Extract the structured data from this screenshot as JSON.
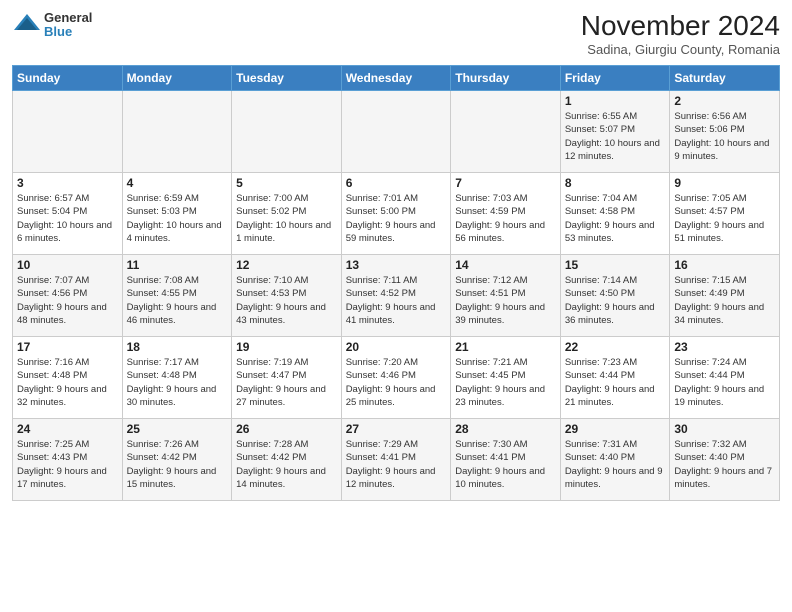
{
  "header": {
    "logo_general": "General",
    "logo_blue": "Blue",
    "month_title": "November 2024",
    "subtitle": "Sadina, Giurgiu County, Romania"
  },
  "days_of_week": [
    "Sunday",
    "Monday",
    "Tuesday",
    "Wednesday",
    "Thursday",
    "Friday",
    "Saturday"
  ],
  "weeks": [
    [
      {
        "day": "",
        "info": ""
      },
      {
        "day": "",
        "info": ""
      },
      {
        "day": "",
        "info": ""
      },
      {
        "day": "",
        "info": ""
      },
      {
        "day": "",
        "info": ""
      },
      {
        "day": "1",
        "info": "Sunrise: 6:55 AM\nSunset: 5:07 PM\nDaylight: 10 hours and 12 minutes."
      },
      {
        "day": "2",
        "info": "Sunrise: 6:56 AM\nSunset: 5:06 PM\nDaylight: 10 hours and 9 minutes."
      }
    ],
    [
      {
        "day": "3",
        "info": "Sunrise: 6:57 AM\nSunset: 5:04 PM\nDaylight: 10 hours and 6 minutes."
      },
      {
        "day": "4",
        "info": "Sunrise: 6:59 AM\nSunset: 5:03 PM\nDaylight: 10 hours and 4 minutes."
      },
      {
        "day": "5",
        "info": "Sunrise: 7:00 AM\nSunset: 5:02 PM\nDaylight: 10 hours and 1 minute."
      },
      {
        "day": "6",
        "info": "Sunrise: 7:01 AM\nSunset: 5:00 PM\nDaylight: 9 hours and 59 minutes."
      },
      {
        "day": "7",
        "info": "Sunrise: 7:03 AM\nSunset: 4:59 PM\nDaylight: 9 hours and 56 minutes."
      },
      {
        "day": "8",
        "info": "Sunrise: 7:04 AM\nSunset: 4:58 PM\nDaylight: 9 hours and 53 minutes."
      },
      {
        "day": "9",
        "info": "Sunrise: 7:05 AM\nSunset: 4:57 PM\nDaylight: 9 hours and 51 minutes."
      }
    ],
    [
      {
        "day": "10",
        "info": "Sunrise: 7:07 AM\nSunset: 4:56 PM\nDaylight: 9 hours and 48 minutes."
      },
      {
        "day": "11",
        "info": "Sunrise: 7:08 AM\nSunset: 4:55 PM\nDaylight: 9 hours and 46 minutes."
      },
      {
        "day": "12",
        "info": "Sunrise: 7:10 AM\nSunset: 4:53 PM\nDaylight: 9 hours and 43 minutes."
      },
      {
        "day": "13",
        "info": "Sunrise: 7:11 AM\nSunset: 4:52 PM\nDaylight: 9 hours and 41 minutes."
      },
      {
        "day": "14",
        "info": "Sunrise: 7:12 AM\nSunset: 4:51 PM\nDaylight: 9 hours and 39 minutes."
      },
      {
        "day": "15",
        "info": "Sunrise: 7:14 AM\nSunset: 4:50 PM\nDaylight: 9 hours and 36 minutes."
      },
      {
        "day": "16",
        "info": "Sunrise: 7:15 AM\nSunset: 4:49 PM\nDaylight: 9 hours and 34 minutes."
      }
    ],
    [
      {
        "day": "17",
        "info": "Sunrise: 7:16 AM\nSunset: 4:48 PM\nDaylight: 9 hours and 32 minutes."
      },
      {
        "day": "18",
        "info": "Sunrise: 7:17 AM\nSunset: 4:48 PM\nDaylight: 9 hours and 30 minutes."
      },
      {
        "day": "19",
        "info": "Sunrise: 7:19 AM\nSunset: 4:47 PM\nDaylight: 9 hours and 27 minutes."
      },
      {
        "day": "20",
        "info": "Sunrise: 7:20 AM\nSunset: 4:46 PM\nDaylight: 9 hours and 25 minutes."
      },
      {
        "day": "21",
        "info": "Sunrise: 7:21 AM\nSunset: 4:45 PM\nDaylight: 9 hours and 23 minutes."
      },
      {
        "day": "22",
        "info": "Sunrise: 7:23 AM\nSunset: 4:44 PM\nDaylight: 9 hours and 21 minutes."
      },
      {
        "day": "23",
        "info": "Sunrise: 7:24 AM\nSunset: 4:44 PM\nDaylight: 9 hours and 19 minutes."
      }
    ],
    [
      {
        "day": "24",
        "info": "Sunrise: 7:25 AM\nSunset: 4:43 PM\nDaylight: 9 hours and 17 minutes."
      },
      {
        "day": "25",
        "info": "Sunrise: 7:26 AM\nSunset: 4:42 PM\nDaylight: 9 hours and 15 minutes."
      },
      {
        "day": "26",
        "info": "Sunrise: 7:28 AM\nSunset: 4:42 PM\nDaylight: 9 hours and 14 minutes."
      },
      {
        "day": "27",
        "info": "Sunrise: 7:29 AM\nSunset: 4:41 PM\nDaylight: 9 hours and 12 minutes."
      },
      {
        "day": "28",
        "info": "Sunrise: 7:30 AM\nSunset: 4:41 PM\nDaylight: 9 hours and 10 minutes."
      },
      {
        "day": "29",
        "info": "Sunrise: 7:31 AM\nSunset: 4:40 PM\nDaylight: 9 hours and 9 minutes."
      },
      {
        "day": "30",
        "info": "Sunrise: 7:32 AM\nSunset: 4:40 PM\nDaylight: 9 hours and 7 minutes."
      }
    ]
  ]
}
